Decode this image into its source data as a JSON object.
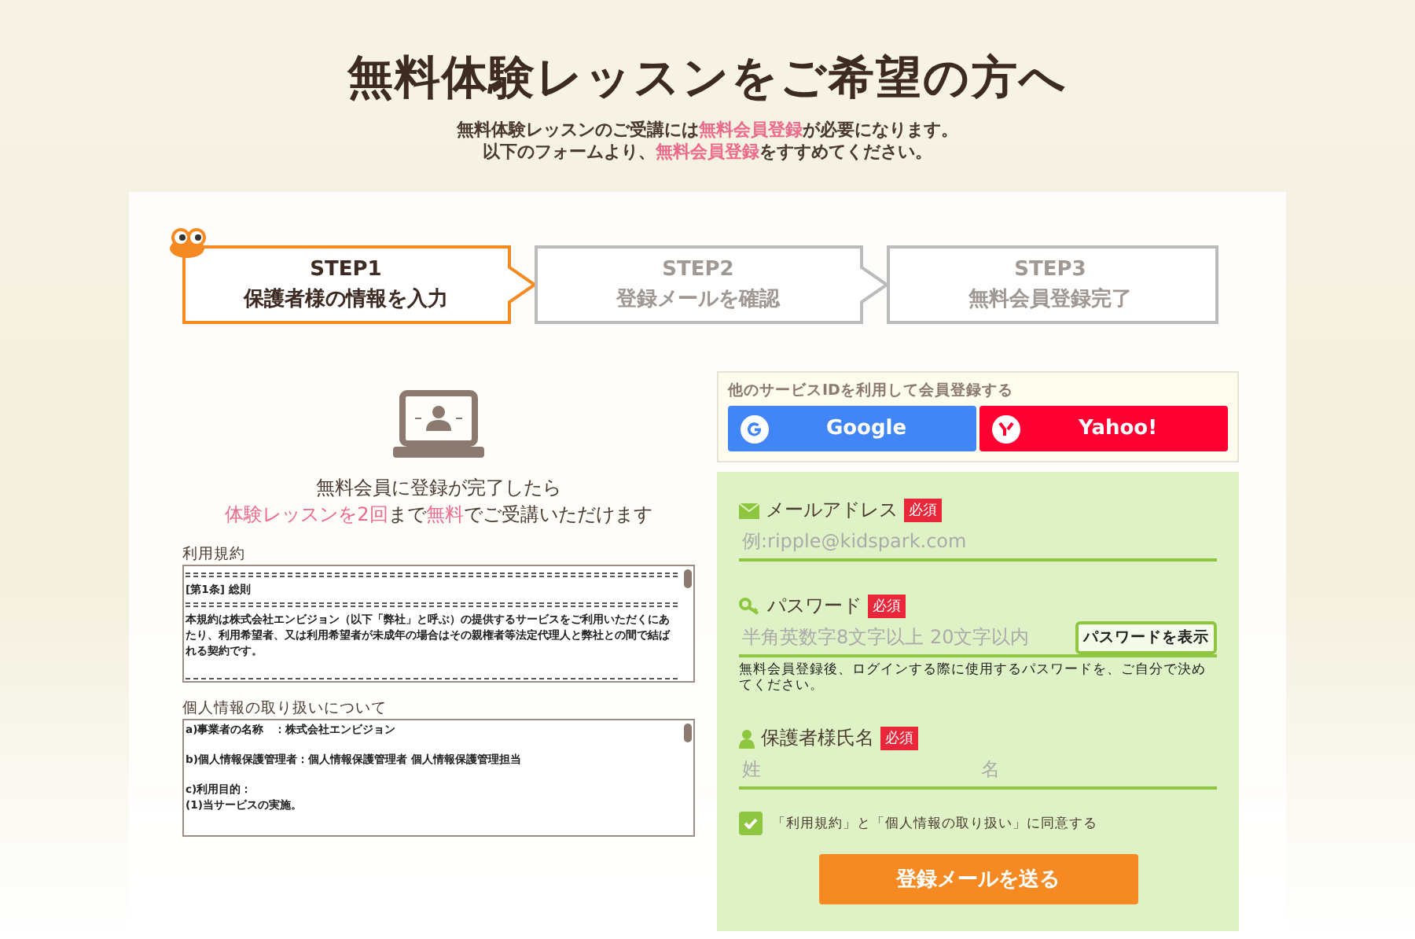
{
  "heading": {
    "title": "無料体験レッスンをご希望の方へ",
    "lines": [
      "無料体験レッスンのご受講には**無料会員登録**が必要になります。",
      "以下のフォームより、**無料会員登録**をすすめてください。"
    ]
  },
  "steps": [
    {
      "number": "STEP1",
      "label": "保護者様の情報を入力",
      "selected": true
    },
    {
      "number": "STEP2",
      "label": "登録メールを確認",
      "selected": false
    },
    {
      "number": "STEP3",
      "label": "無料会員登録完了",
      "selected": false
    }
  ],
  "promo": {
    "lines": [
      "無料会員に登録が完了したら",
      "**体験レッスンを2回**まで**無料**でご受講いただけます"
    ]
  },
  "terms": {
    "title": "利用規約",
    "blocks": [
      {
        "kind": "rule"
      },
      {
        "kind": "text",
        "text": "[第1条] 総則"
      },
      {
        "kind": "rule"
      },
      {
        "kind": "text",
        "text": "本規約は株式会社エンビジョン（以下「弊社」と呼ぶ）の提供するサービスをご利用いただくにあたり、利用希望者、又は利用希望者が未成年の場合はその親権者等法定代理人と弊社との間で結ばれる契約です。"
      },
      {
        "kind": "gap"
      },
      {
        "kind": "rule"
      }
    ]
  },
  "privacy": {
    "title": "個人情報の取り扱いについて",
    "blocks": [
      {
        "kind": "text",
        "text": "a)事業者の名称　：株式会社エンビジョン"
      },
      {
        "kind": "gap"
      },
      {
        "kind": "text",
        "text": "b)個人情報保護管理者：個人情報保護管理者 個人情報保護管理担当"
      },
      {
        "kind": "gap"
      },
      {
        "kind": "text",
        "text": "c)利用目的："
      },
      {
        "kind": "text",
        "text": "(1)当サービスの実施。"
      }
    ]
  },
  "social": {
    "title": "他のサービスIDを利用して会員登録する",
    "buttons": [
      {
        "kind": "google",
        "label": "Google"
      },
      {
        "kind": "yahoo",
        "label": "Yahoo!"
      }
    ]
  },
  "form": {
    "fields": [
      {
        "kind": "email",
        "label": "メールアドレス",
        "required": "必須",
        "placeholder": "例:ripple@kidspark.com"
      },
      {
        "kind": "password",
        "label": "パスワード",
        "required": "必須",
        "placeholder": "半角英数字8文字以上 20文字以内",
        "toggle": "パスワードを表示",
        "hint": "無料会員登録後、ログインする際に使用するパスワードを、ご自分で決めてください。"
      },
      {
        "kind": "name",
        "label": "保護者様氏名",
        "required": "必須",
        "placeholders": [
          "姓",
          "名"
        ]
      }
    ],
    "agree": {
      "label": "「利用規約」と「個人情報の取り扱い」に同意する",
      "checked": true
    },
    "submit": "登録メールを送る"
  }
}
